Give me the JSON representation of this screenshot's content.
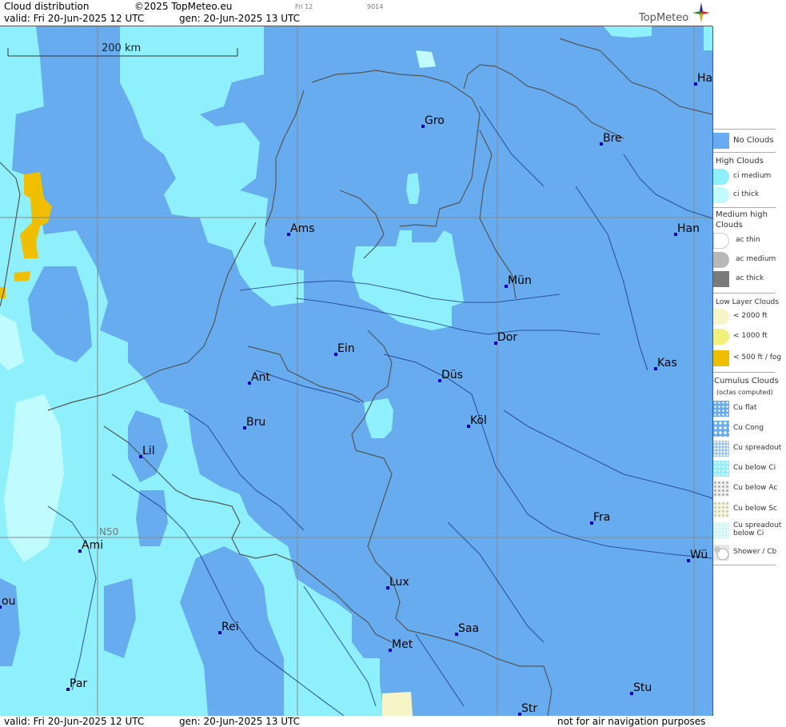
{
  "header": {
    "title": "Cloud distribution",
    "copyright": "©2025 TopMeteo.eu",
    "valid": "valid:  Fri  20-Jun-2025  12 UTC",
    "gen": "gen: 20-Jun-2025 13 UTC",
    "code_a": "Fri 12",
    "code_b": "9014",
    "brand": "TopMeteo"
  },
  "footer": {
    "valid": "valid:  Fri  20-Jun-2025  12 UTC",
    "gen": "gen: 20-Jun-2025 13 UTC",
    "disclaimer": "not for air navigation purposes"
  },
  "map": {
    "scale_label": "200 km",
    "lat_label": "N50",
    "colors": {
      "no_clouds": "#67acef",
      "ci_medium": "#8ef0fb",
      "ci_thick": "#c0fbff",
      "low_2000": "#f5f5c8",
      "low_500": "#f0c000"
    },
    "cities": [
      {
        "name": "Gro"
      },
      {
        "name": "Bre"
      },
      {
        "name": "Ha"
      },
      {
        "name": "Ams"
      },
      {
        "name": "Han"
      },
      {
        "name": "Mün"
      },
      {
        "name": "Dor"
      },
      {
        "name": "Ein"
      },
      {
        "name": "Ant"
      },
      {
        "name": "Düs"
      },
      {
        "name": "Kas"
      },
      {
        "name": "Bru"
      },
      {
        "name": "Köl"
      },
      {
        "name": "Lil"
      },
      {
        "name": "Fra"
      },
      {
        "name": "Ami"
      },
      {
        "name": "Wü"
      },
      {
        "name": "Lux"
      },
      {
        "name": "ou"
      },
      {
        "name": "Rei"
      },
      {
        "name": "Saa"
      },
      {
        "name": "Met"
      },
      {
        "name": "Par"
      },
      {
        "name": "Stu"
      },
      {
        "name": "Str"
      }
    ]
  },
  "legend": {
    "no_clouds": "No Clouds",
    "high_clouds": "High Clouds",
    "ci_medium": "ci medium",
    "ci_thick": "ci thick",
    "medium_high_1": "Medium high",
    "medium_high_2": "Clouds",
    "ac_thin": "ac thin",
    "ac_medium": "ac medium",
    "ac_thick": "ac thick",
    "low_layer": "Low Layer Clouds",
    "low_2000": "< 2000 ft",
    "low_1000": "< 1000 ft",
    "low_500": "< 500 ft / fog",
    "cumulus": "Cumulus Clouds",
    "cumulus_sub": "(octas computed)",
    "cu_flat": "Cu flat",
    "cu_cong": "Cu Cong",
    "cu_spreadout": "Cu spreadout",
    "cu_below_ci": "Cu below Ci",
    "cu_below_ac": "Cu below Ac",
    "cu_below_sc": "Cu below Sc",
    "cu_spread_ci_1": "Cu spreadout",
    "cu_spread_ci_2": "below Ci",
    "shower": "Shower / Cb"
  }
}
